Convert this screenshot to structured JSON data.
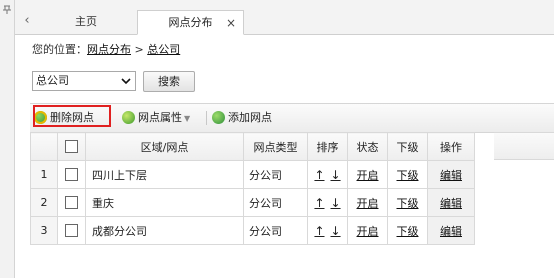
{
  "dock": {
    "pin_icon": "pin-icon"
  },
  "tabs": {
    "scroll_left_glyph": "‹",
    "items": [
      {
        "label": "主页"
      },
      {
        "label": "网点分布",
        "close": "×"
      }
    ]
  },
  "breadcrumb": {
    "prefix": "您的位置：",
    "link1": "网点分布",
    "separator": " > ",
    "link2": "总公司"
  },
  "filter": {
    "select_value": "总公司",
    "search_label": "搜索"
  },
  "toolbar": {
    "delete_label": "删除网点",
    "properties_label": "网点属性",
    "add_label": "添加网点",
    "highlight_color": "#e02020"
  },
  "table": {
    "headers": [
      "",
      "",
      "区域/网点",
      "网点类型",
      "排序",
      "状态",
      "下级",
      "操作"
    ],
    "rows": [
      {
        "num": "1",
        "region": "四川上下层",
        "type": "分公司",
        "sort_up": "↑",
        "sort_down": "↓",
        "status": "开启",
        "sub": "下级",
        "op": "编辑"
      },
      {
        "num": "2",
        "region": "重庆",
        "type": "分公司",
        "sort_up": "↑",
        "sort_down": "↓",
        "status": "开启",
        "sub": "下级",
        "op": "编辑"
      },
      {
        "num": "3",
        "region": "成都分公司",
        "type": "分公司",
        "sort_up": "↑",
        "sort_down": "↓",
        "status": "开启",
        "sub": "下级",
        "op": "编辑"
      }
    ]
  }
}
